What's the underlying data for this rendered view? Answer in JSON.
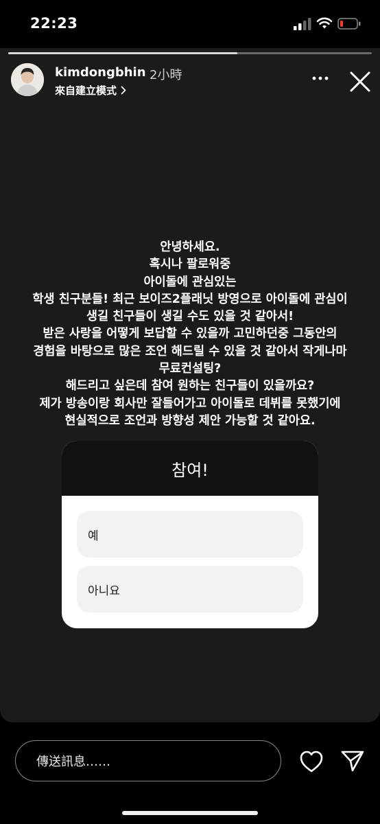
{
  "status_bar": {
    "time": "22:23"
  },
  "story": {
    "progress": 0.63,
    "username": "kimdongbhin",
    "age": "2小時",
    "subtitle": "來自建立模式",
    "caption_lines": [
      "안녕하세요.",
      "혹시나 팔로워중",
      "아이돌에 관심있는",
      "학생 친구분들! 최근 보이즈2플래닛 방영으로 아이돌에 관심이",
      "생길 친구들이 생길 수도 있을 것 같아서!",
      "받은 사랑을 어떻게 보답할 수 있을까 고민하던중 그동안의",
      "경험을 바탕으로 많은 조언 해드릴 수 있을 것 같아서 작게나마",
      "무료컨설팅?",
      "해드리고 싶은데 참여 원하는 친구들이 있을까요?",
      "제가 방송이랑 회사만 잘들어가고 아이돌로 데뷔를 못했기에",
      "현실적으로 조언과 방향성 제안 가능할 것 같아요."
    ],
    "poll": {
      "title": "참여!",
      "options": [
        "예",
        "아니요"
      ]
    }
  },
  "reply_bar": {
    "placeholder": "傳送訊息……"
  },
  "icons": {
    "more": "more-icon",
    "close": "close-icon",
    "chevron": "chevron-right-icon",
    "heart": "heart-icon",
    "send": "send-icon"
  }
}
